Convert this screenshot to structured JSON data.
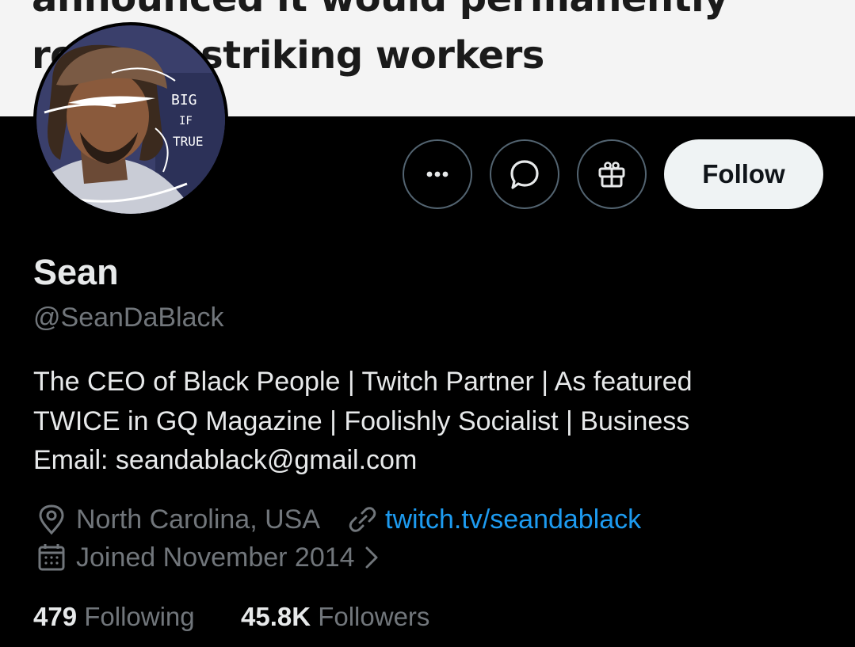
{
  "banner": {
    "line1": "announced it would permanently",
    "line2": "replace striking workers",
    "avatar_text_1": "BIG",
    "avatar_text_2": "IF",
    "avatar_text_3": "TRUE"
  },
  "actions": {
    "more_icon": "ellipsis-icon",
    "message_icon": "message-bubble-icon",
    "gift_icon": "gift-icon",
    "follow_label": "Follow"
  },
  "profile": {
    "name": "Sean",
    "handle": "@SeanDaBlack",
    "bio_lines": [
      "The CEO of Black People | Twitch Partner | As featured",
      "TWICE in GQ Magazine | Foolishly Socialist | Business",
      "Email: seandablack@gmail.com"
    ],
    "location": "North Carolina, USA",
    "website": "twitch.tv/seandablack",
    "joined": "Joined November 2014"
  },
  "stats": {
    "following_count": "479",
    "following_label": "Following",
    "followers_count": "45.8K",
    "followers_label": "Followers"
  },
  "colors": {
    "background": "#000000",
    "text_primary": "#e7e9ea",
    "text_secondary": "#71767b",
    "link": "#1d9bf0",
    "follow_button_bg": "#eff3f4"
  }
}
